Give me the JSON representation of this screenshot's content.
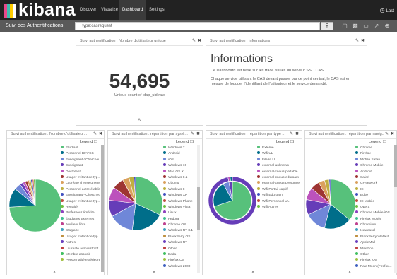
{
  "nav": {
    "logo": "kibana",
    "tabs": [
      "Discover",
      "Visualize",
      "Dashboard",
      "Settings"
    ],
    "right_label": "Last"
  },
  "subbar": {
    "title": "Suivi des Authentifications",
    "search_value": "_type:casrequest"
  },
  "metric_panel": {
    "title": "Suivi authentification : Nombre d'utilisateur unique",
    "value": "54,695",
    "label": "Unique count of ldap_uid.raw"
  },
  "info_panel": {
    "title": "Suivi authentification : Informations",
    "heading": "Informations",
    "paragraph1": "Ce Dashboard est basé sur les trace issues du serveur SSO CAS.",
    "paragraph2": "Chaque service utilisant le CAS devant passer par ce point central, le CAS est en mesure de logguer l'identifiant de l'utilisateur et le service demandé."
  },
  "pie_panels": [
    {
      "title": "Suivi authentification : Nombre d'utilisateur...",
      "legend_label": "Legend",
      "items": [
        {
          "label": "Etudiant",
          "color": "#57c17b"
        },
        {
          "label": "Personnel BIATSS",
          "color": "#006e8a"
        },
        {
          "label": "Enseignant / Chercheur",
          "color": "#6f87d8"
        },
        {
          "label": "Enseignant",
          "color": "#663db8"
        },
        {
          "label": "Doctorant",
          "color": "#bc52bc"
        },
        {
          "label": "Usager n'étant de typ...",
          "color": "#9e3533"
        },
        {
          "label": "Lauréate d'enseigneme...",
          "color": "#daa05d"
        },
        {
          "label": "Personnel autre établis...",
          "color": "#bfaf40"
        },
        {
          "label": "Enseignant - Chercheu...",
          "color": "#4050bf"
        },
        {
          "label": "Usager n'étant de typ...",
          "color": "#bf5040"
        },
        {
          "label": "Retraité",
          "color": "#70bf40"
        },
        {
          "label": "Professeur émérite",
          "color": "#8f40bf"
        },
        {
          "label": "Étudiants Externes",
          "color": "#40bf8f"
        },
        {
          "label": "Auditeur libre",
          "color": "#bf408f"
        },
        {
          "label": "Stagiaire",
          "color": "#40a0bf"
        },
        {
          "label": "Usager n'étant de typ...",
          "color": "#bf9040"
        },
        {
          "label": "Autres",
          "color": "#6a40bf"
        },
        {
          "label": "Lauréate administratif",
          "color": "#bf4040"
        },
        {
          "label": "Membre associé",
          "color": "#40bf60"
        },
        {
          "label": "Personnalité extérieure",
          "color": "#a0bf40"
        }
      ],
      "slices": [
        {
          "value": 74,
          "color": "#57c17b"
        },
        {
          "value": 12,
          "color": "#006e8a"
        },
        {
          "value": 4,
          "color": "#6f87d8"
        },
        {
          "value": 2,
          "color": "#663db8"
        },
        {
          "value": 1.5,
          "color": "#bc52bc"
        },
        {
          "value": 1.5,
          "color": "#9e3533"
        },
        {
          "value": 1.2,
          "color": "#daa05d"
        },
        {
          "value": 1,
          "color": "#bfaf40"
        },
        {
          "value": 1,
          "color": "#4050bf"
        },
        {
          "value": 0.8,
          "color": "#bf5040"
        },
        {
          "value": 1,
          "color": "#70bf40"
        }
      ]
    },
    {
      "title": "Suivi authentification : répartition par systè...",
      "legend_label": "Legend",
      "items": [
        {
          "label": "Windows 7",
          "color": "#57c17b"
        },
        {
          "label": "Android",
          "color": "#006e8a"
        },
        {
          "label": "iOS",
          "color": "#6f87d8"
        },
        {
          "label": "Windows 10",
          "color": "#663db8"
        },
        {
          "label": "Mac OS X",
          "color": "#bc52bc"
        },
        {
          "label": "Windows 8.1",
          "color": "#9e3533"
        },
        {
          "label": "Ubuntu",
          "color": "#daa05d"
        },
        {
          "label": "Windows 8",
          "color": "#bfaf40"
        },
        {
          "label": "Windows XP",
          "color": "#4050bf"
        },
        {
          "label": "Windows Phone",
          "color": "#bf5040"
        },
        {
          "label": "Windows Vista",
          "color": "#70bf40"
        },
        {
          "label": "Linux",
          "color": "#8f40bf"
        },
        {
          "label": "Fedora",
          "color": "#40bf8f"
        },
        {
          "label": "Chrome OS",
          "color": "#bf408f"
        },
        {
          "label": "Windows RT 8.1",
          "color": "#40a0bf"
        },
        {
          "label": "BlackBerry OS",
          "color": "#bf9040"
        },
        {
          "label": "Windows RT",
          "color": "#6a40bf"
        },
        {
          "label": "Other",
          "color": "#bf4040"
        },
        {
          "label": "Bada",
          "color": "#40bf60"
        },
        {
          "label": "Firefox OS",
          "color": "#a0bf40"
        },
        {
          "label": "Windows 2000",
          "color": "#4060bf"
        }
      ],
      "slices": [
        {
          "value": 32,
          "color": "#57c17b"
        },
        {
          "value": 20,
          "color": "#006e8a"
        },
        {
          "value": 15,
          "color": "#6f87d8"
        },
        {
          "value": 10,
          "color": "#663db8"
        },
        {
          "value": 8,
          "color": "#bc52bc"
        },
        {
          "value": 7,
          "color": "#9e3533"
        },
        {
          "value": 4,
          "color": "#daa05d"
        },
        {
          "value": 3,
          "color": "#bfaf40"
        },
        {
          "value": 1,
          "color": "#4050bf"
        }
      ]
    },
    {
      "title": "Suivi authentification : répartition par type ...",
      "legend_label": "Legend",
      "items": [
        {
          "label": "Externe",
          "color": "#57c17b"
        },
        {
          "label": "Wifi UL",
          "color": "#006e8a"
        },
        {
          "label": "Filaire UL",
          "color": "#6f87d8"
        },
        {
          "label": "external-unknown",
          "color": "#663db8"
        },
        {
          "label": "external-cnous-portable...",
          "color": "#bc52bc"
        },
        {
          "label": "external-cnous-eduroam",
          "color": "#9e3533"
        },
        {
          "label": "external-cnous-personnel",
          "color": "#daa05d"
        },
        {
          "label": "Wifi Portail captif",
          "color": "#bfaf40"
        },
        {
          "label": "Wifi Eduroam",
          "color": "#4050bf"
        },
        {
          "label": "Wifi Personnel UL",
          "color": "#bf5040"
        },
        {
          "label": "Wifi Autres",
          "color": "#70bf40"
        }
      ],
      "outer_slices": [
        {
          "value": 97,
          "color": "#663db8"
        },
        {
          "value": 1.5,
          "color": "#bc52bc"
        },
        {
          "value": 1.5,
          "color": "#006e8a"
        }
      ],
      "inner_slices": [
        {
          "value": 70,
          "color": "#57c17b"
        },
        {
          "value": 22,
          "color": "#006e8a"
        },
        {
          "value": 5,
          "color": "#6f87d8"
        },
        {
          "value": 3,
          "color": "#663db8"
        }
      ]
    },
    {
      "title": "Suivi authentification : répartition par navig...",
      "legend_label": "Legend",
      "items": [
        {
          "label": "Chrome",
          "color": "#57c17b"
        },
        {
          "label": "Firefox",
          "color": "#006e8a"
        },
        {
          "label": "Mobile Safari",
          "color": "#6f87d8"
        },
        {
          "label": "Chrome Mobile",
          "color": "#663db8"
        },
        {
          "label": "Android",
          "color": "#bc52bc"
        },
        {
          "label": "Safari",
          "color": "#9e3533"
        },
        {
          "label": "CFNetwork",
          "color": "#daa05d"
        },
        {
          "label": "IE",
          "color": "#bfaf40"
        },
        {
          "label": "Edge",
          "color": "#4050bf"
        },
        {
          "label": "IE Mobile",
          "color": "#bf5040"
        },
        {
          "label": "Opera",
          "color": "#70bf40"
        },
        {
          "label": "Chrome Mobile iOS",
          "color": "#8f40bf"
        },
        {
          "label": "Firefox Mobile",
          "color": "#40bf8f"
        },
        {
          "label": "Chromium",
          "color": "#bf408f"
        },
        {
          "label": "Iceweasel",
          "color": "#40a0bf"
        },
        {
          "label": "BlackBerry WebKit",
          "color": "#bf9040"
        },
        {
          "label": "AppleMail",
          "color": "#6a40bf"
        },
        {
          "label": "Maxthon",
          "color": "#bf4040"
        },
        {
          "label": "Other",
          "color": "#40bf60"
        },
        {
          "label": "Firefox iOS",
          "color": "#a0bf40"
        },
        {
          "label": "Pale Moon (Firefox...",
          "color": "#4060bf"
        }
      ],
      "slices": [
        {
          "value": 36,
          "color": "#57c17b"
        },
        {
          "value": 18,
          "color": "#006e8a"
        },
        {
          "value": 14,
          "color": "#6f87d8"
        },
        {
          "value": 10,
          "color": "#663db8"
        },
        {
          "value": 8,
          "color": "#bc52bc"
        },
        {
          "value": 6,
          "color": "#9e3533"
        },
        {
          "value": 4,
          "color": "#daa05d"
        },
        {
          "value": 3,
          "color": "#bfaf40"
        },
        {
          "value": 1,
          "color": "#4050bf"
        }
      ]
    }
  ]
}
